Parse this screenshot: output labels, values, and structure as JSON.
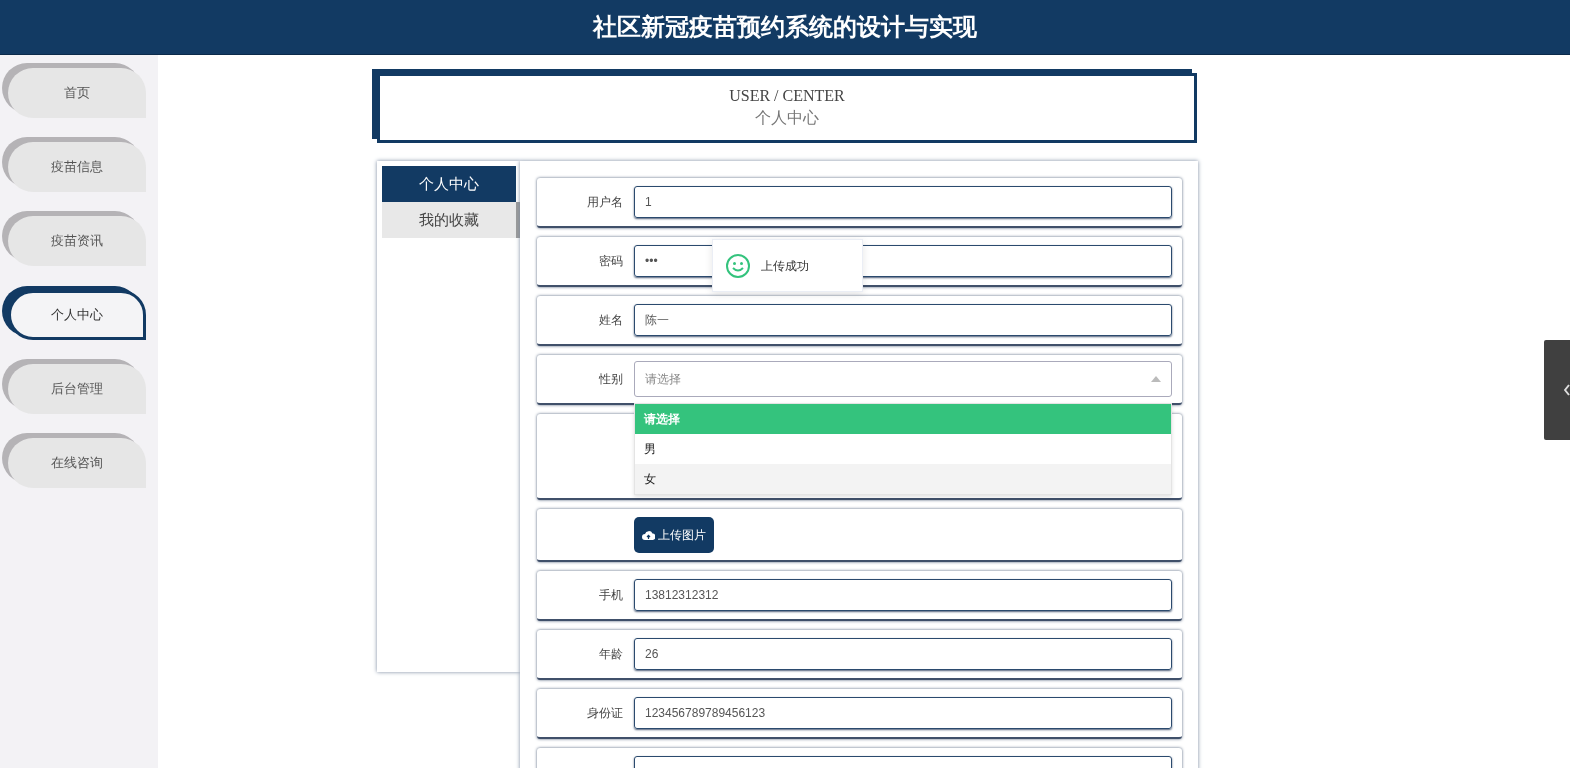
{
  "header": {
    "title": "社区新冠疫苗预约系统的设计与实现"
  },
  "nav": [
    {
      "label": "首页",
      "selected": false
    },
    {
      "label": "疫苗信息",
      "selected": false
    },
    {
      "label": "疫苗资讯",
      "selected": false
    },
    {
      "label": "个人中心",
      "selected": true
    },
    {
      "label": "后台管理",
      "selected": false
    },
    {
      "label": "在线咨询",
      "selected": false
    }
  ],
  "banner": {
    "title": "USER / CENTER",
    "subtitle": "个人中心"
  },
  "side_menu": [
    {
      "label": "个人中心",
      "selected": true
    },
    {
      "label": "我的收藏",
      "selected": false
    }
  ],
  "form": [
    {
      "kind": "input",
      "label": "用户名",
      "value": "1"
    },
    {
      "kind": "input",
      "label": "密码",
      "value": "•••"
    },
    {
      "kind": "input",
      "label": "姓名",
      "value": "陈一"
    },
    {
      "kind": "select",
      "label": "性别",
      "placeholder": "请选择",
      "options": [
        {
          "label": "请选择",
          "selected": true,
          "hovered": false
        },
        {
          "label": "男",
          "selected": false,
          "hovered": false
        },
        {
          "label": "女",
          "selected": false,
          "hovered": true
        }
      ]
    },
    {
      "kind": "image"
    },
    {
      "kind": "upload",
      "button": "上传图片"
    },
    {
      "kind": "input",
      "label": "手机",
      "value": "13812312312"
    },
    {
      "kind": "input",
      "label": "年龄",
      "value": "26"
    },
    {
      "kind": "input",
      "label": "身份证",
      "value": "123456789789456123"
    },
    {
      "kind": "input"
    }
  ],
  "toast": {
    "message": "上传成功"
  }
}
